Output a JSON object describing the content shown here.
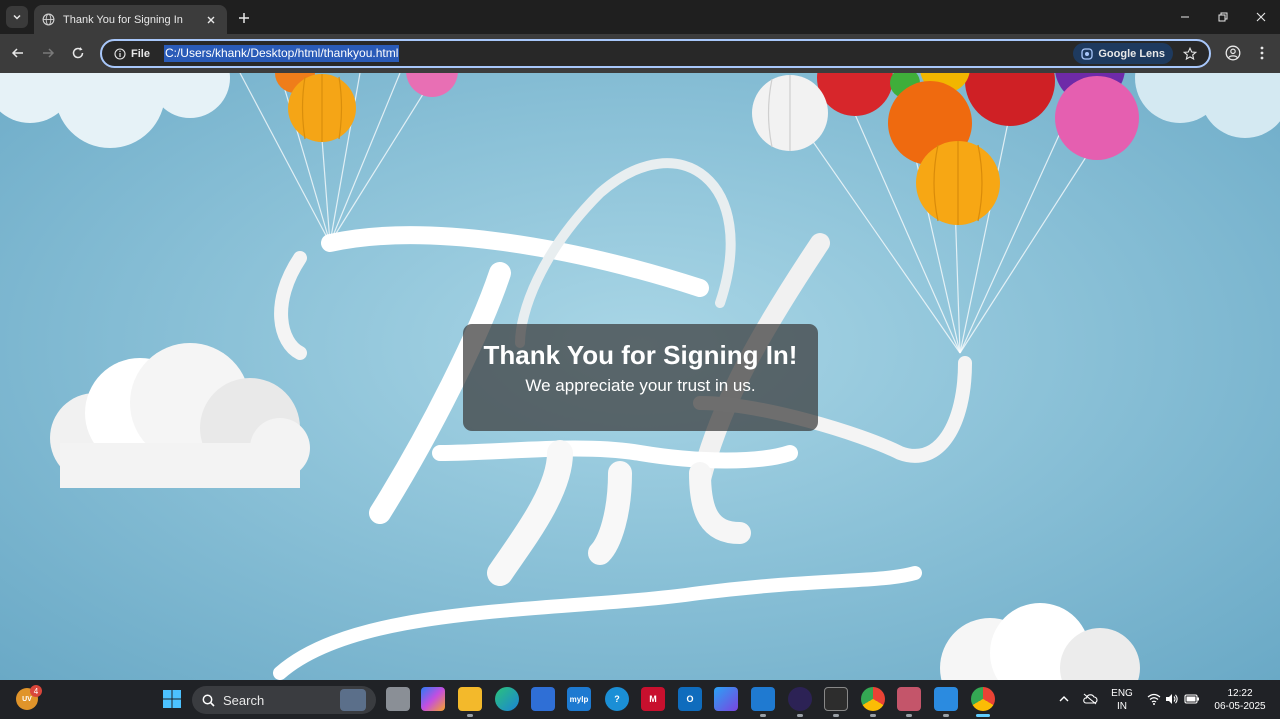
{
  "browser": {
    "tab_title": "Thank You for Signing In",
    "site_chip_label": "File",
    "url": "C:/Users/khank/Desktop/html/thankyou.html",
    "lens_label": "Google Lens"
  },
  "page": {
    "heading": "Thank You for Signing In!",
    "subtext": "We appreciate your trust in us.",
    "background_art_text": "Thank you"
  },
  "taskbar": {
    "widget_label": "UV",
    "widget_badge": "4",
    "search_label": "Search",
    "pinned_apps": [
      "task-view",
      "copilot",
      "file-explorer",
      "edge",
      "microsoft-store",
      "mylp",
      "help",
      "mcafee",
      "outlook",
      "bing",
      "vscode",
      "eclipse",
      "terminal",
      "chrome",
      "snipping-tool",
      "photos",
      "chrome-active"
    ],
    "tray": {
      "language": "ENG",
      "region": "IN",
      "time": "12:22",
      "date": "06-05-2025"
    }
  },
  "colors": {
    "accent": "#a8c7fa",
    "selection": "#2a5bb8",
    "card_bg": "rgba(58,58,58,0.72)",
    "sky": "#8cc2d8"
  }
}
